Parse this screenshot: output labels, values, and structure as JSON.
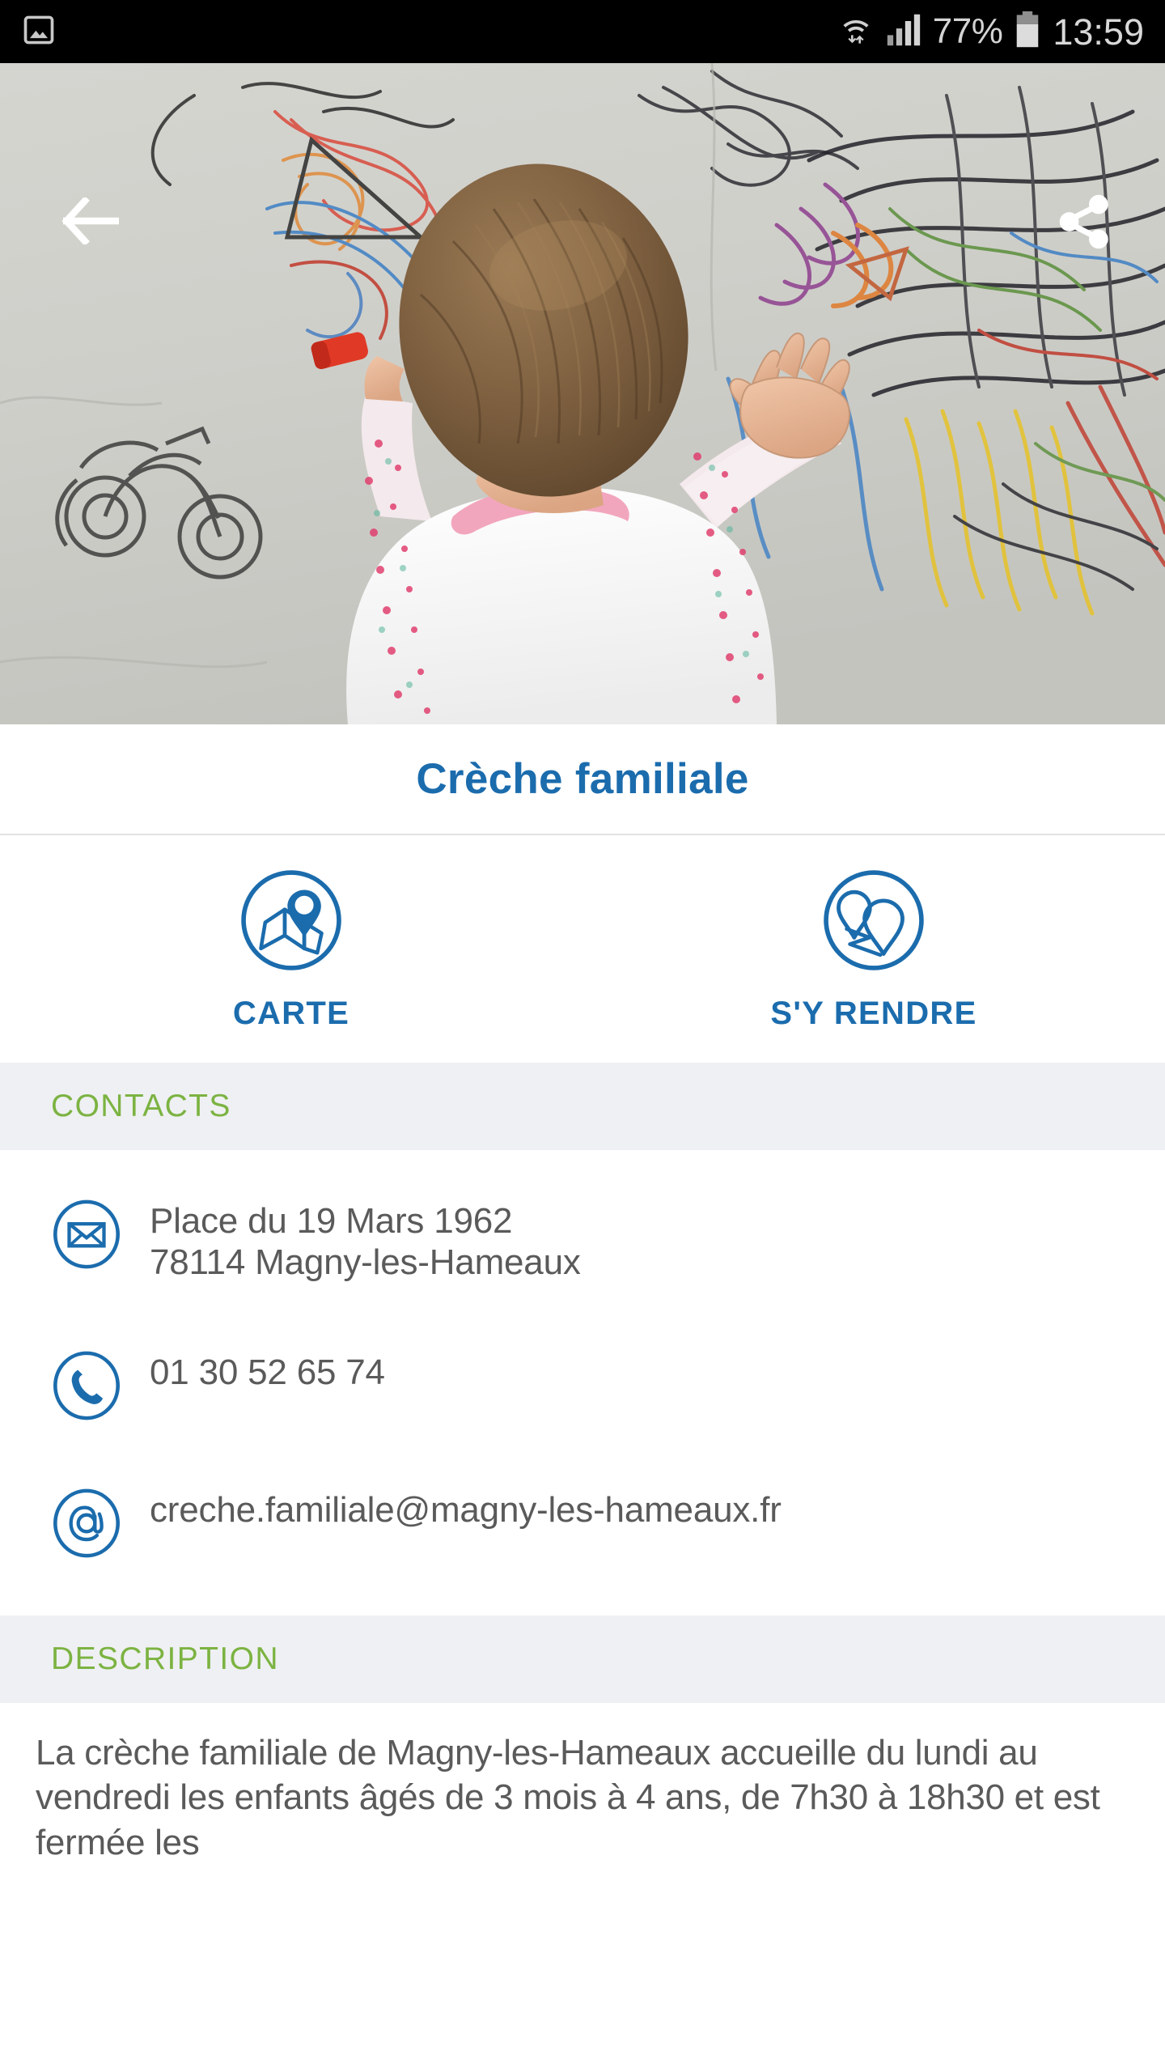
{
  "statusbar": {
    "left_icon": "image-icon",
    "wifi_icon": "wifi-transfer-icon",
    "signal_icon": "cellular-signal-icon",
    "battery_text": "77%",
    "battery_icon": "battery-icon",
    "clock": "13:59"
  },
  "hero": {
    "alt": "toddler drawing with crayons on a large sheet of paper covered in colourful scribbles",
    "back_icon": "back-arrow-icon",
    "share_icon": "share-icon"
  },
  "page": {
    "title": "Crèche familiale",
    "accent_blue": "#1b6cad",
    "accent_green": "#7cb342",
    "text_gray": "#5a5a5a",
    "band_gray": "#eff0f3"
  },
  "actions": [
    {
      "label": "CARTE",
      "icon": "map-pin-circle-icon"
    },
    {
      "label": "S'Y RENDRE",
      "icon": "route-pins-circle-icon"
    }
  ],
  "contacts": {
    "heading": "CONTACTS",
    "items": [
      {
        "icon": "envelope-circle-icon",
        "lines": [
          "Place du 19 Mars 1962",
          "78114 Magny-les-Hameaux"
        ]
      },
      {
        "icon": "phone-circle-icon",
        "lines": [
          "01 30 52 65 74"
        ]
      },
      {
        "icon": "at-sign-circle-icon",
        "lines": [
          "creche.familiale@magny-les-hameaux.fr"
        ]
      }
    ]
  },
  "description": {
    "heading": "DESCRIPTION",
    "body": "La crèche familiale de Magny-les-Hameaux accueille du lundi au vendredi les enfants âgés de 3 mois à 4 ans, de 7h30 à 18h30 et est fermée les"
  }
}
